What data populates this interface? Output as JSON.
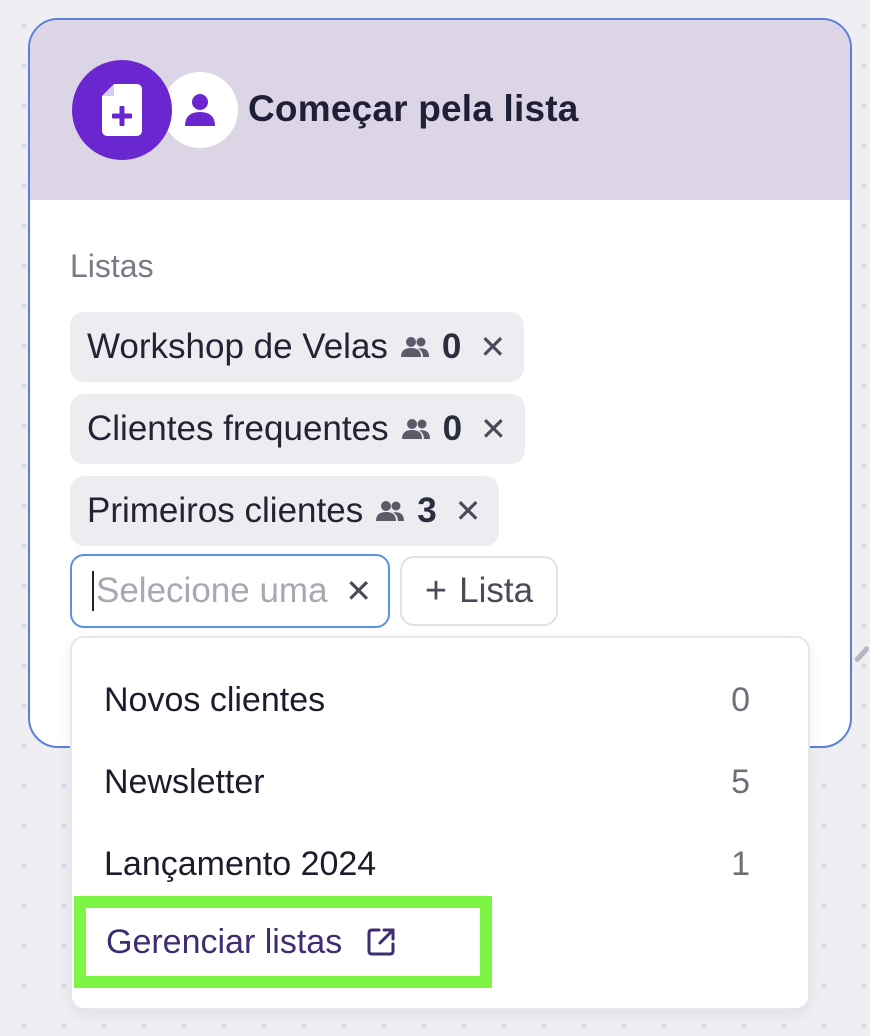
{
  "card": {
    "title": "Começar pela lista",
    "primary_icon": "file-add-icon",
    "secondary_icon": "user-icon"
  },
  "lists_section": {
    "label": "Listas",
    "chips": [
      {
        "name": "Workshop de Velas",
        "count": "0"
      },
      {
        "name": "Clientes frequentes",
        "count": "0"
      },
      {
        "name": "Primeiros clientes",
        "count": "3"
      }
    ]
  },
  "select": {
    "placeholder": "Selecione uma"
  },
  "add_list_button": {
    "label": "Lista"
  },
  "dropdown": {
    "items": [
      {
        "name": "Novos clientes",
        "count": "0"
      },
      {
        "name": "Newsletter",
        "count": "5"
      },
      {
        "name": "Lançamento 2024",
        "count": "1"
      }
    ],
    "manage_link": "Gerenciar listas"
  },
  "colors": {
    "card_border": "#5b7fdc",
    "header_bg": "#dcd5e6",
    "brand_purple": "#6a26cf",
    "highlight": "#7ef545"
  }
}
